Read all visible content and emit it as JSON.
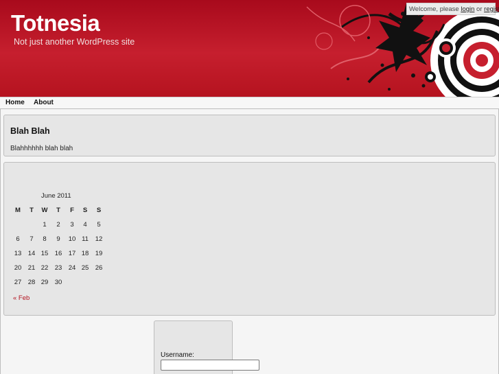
{
  "site": {
    "title": "Totnesia",
    "tagline": "Not just another WordPress site"
  },
  "welcome": {
    "prefix": "Welcome, please ",
    "login": "login",
    "separator": " or ",
    "register": "register"
  },
  "nav": {
    "items": [
      {
        "label": "Home"
      },
      {
        "label": "About"
      }
    ]
  },
  "post": {
    "title": "Blah Blah",
    "body": "Blahhhhhh blah blah"
  },
  "calendar": {
    "caption": "June 2011",
    "weekdays": [
      "M",
      "T",
      "W",
      "T",
      "F",
      "S",
      "S"
    ],
    "weeks": [
      [
        "",
        "",
        "1",
        "2",
        "3",
        "4",
        "5"
      ],
      [
        "6",
        "7",
        "8",
        "9",
        "10",
        "11",
        "12"
      ],
      [
        "13",
        "14",
        "15",
        "16",
        "17",
        "18",
        "19"
      ],
      [
        "20",
        "21",
        "22",
        "23",
        "24",
        "25",
        "26"
      ],
      [
        "27",
        "28",
        "29",
        "30",
        "",
        "",
        ""
      ]
    ],
    "prev_link": "« Feb"
  },
  "login_form": {
    "username_label": "Username:",
    "username_value": ""
  },
  "colors": {
    "header_red": "#c61f2e",
    "link_red": "#b3121f"
  }
}
